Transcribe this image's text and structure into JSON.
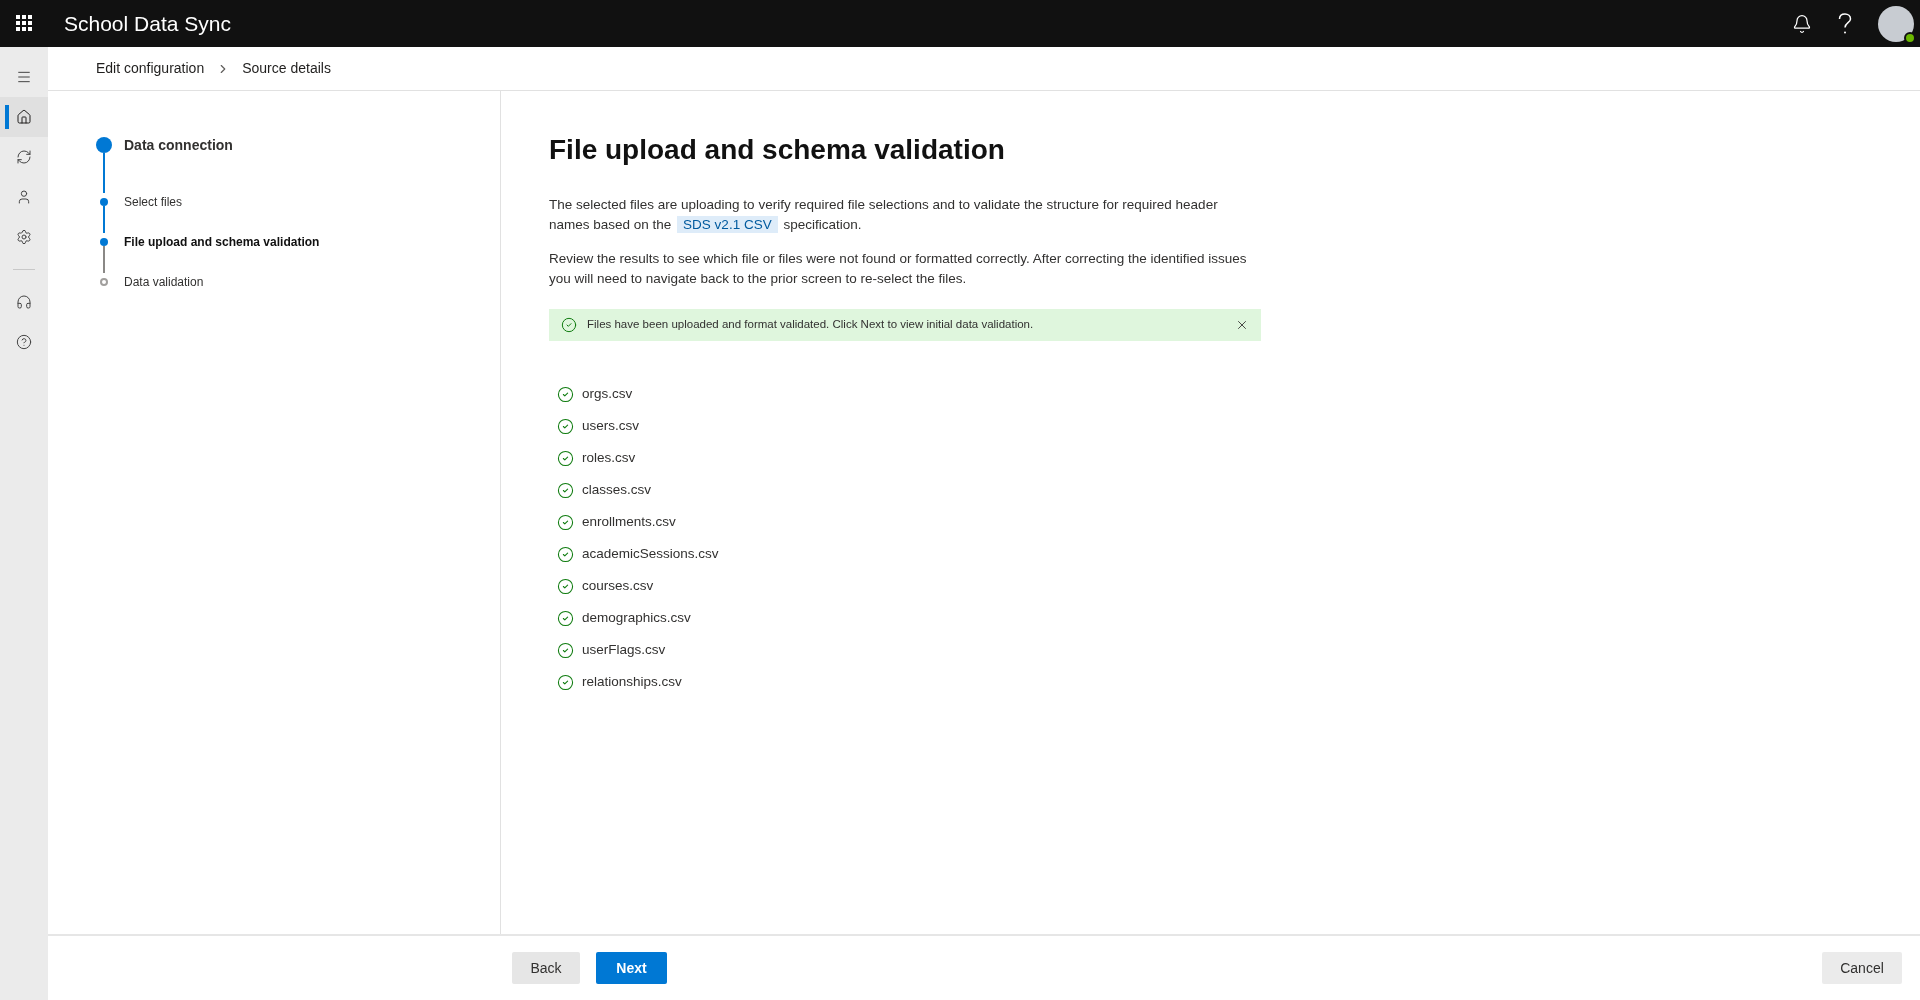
{
  "app": {
    "title": "School Data Sync"
  },
  "rail_top": [
    {
      "kind": "home",
      "selected": true
    },
    {
      "kind": "sync",
      "selected": false
    },
    {
      "kind": "person",
      "selected": false
    },
    {
      "kind": "settings",
      "selected": false
    }
  ],
  "rail_bottom": [
    {
      "kind": "headset",
      "selected": false
    },
    {
      "kind": "help",
      "selected": false
    }
  ],
  "breadcrumb": [
    "Edit configuration",
    "Source details"
  ],
  "steps": [
    {
      "label": "Data connection",
      "kind": "section",
      "completed": true,
      "selected": false
    },
    {
      "label": "Select files",
      "kind": "sub",
      "completed": true,
      "selected": false
    },
    {
      "label": "File upload and schema validation",
      "kind": "sub",
      "completed": true,
      "selected": true
    },
    {
      "label": "Data validation",
      "kind": "sub",
      "completed": false,
      "selected": false
    }
  ],
  "page": {
    "title": "File upload and schema validation",
    "intro_before": "The selected files are uploading to verify required file selections and to validate the structure for required header names based on the",
    "intro_link": "SDS v2.1 CSV",
    "intro_after": "specification.",
    "review": "Review the results to see which file or files were not found or formatted correctly. After correcting the identified issues you will need to navigate back to the prior screen to re-select the files."
  },
  "banner": {
    "kind": "success",
    "message": "Files have been uploaded and format validated. Click Next to view initial data validation."
  },
  "files": [
    {
      "name": "orgs.csv",
      "valid": true
    },
    {
      "name": "users.csv",
      "valid": true
    },
    {
      "name": "roles.csv",
      "valid": true
    },
    {
      "name": "classes.csv",
      "valid": true
    },
    {
      "name": "enrollments.csv",
      "valid": true
    },
    {
      "name": "academicSessions.csv",
      "valid": true
    },
    {
      "name": "courses.csv",
      "valid": true
    },
    {
      "name": "demographics.csv",
      "valid": true
    },
    {
      "name": "userFlags.csv",
      "valid": true
    },
    {
      "name": "relationships.csv",
      "valid": true
    }
  ],
  "footer": {
    "back": "Back",
    "next": "Next",
    "cancel": "Cancel"
  }
}
